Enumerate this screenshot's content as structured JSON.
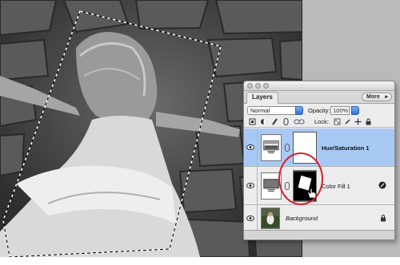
{
  "panel": {
    "tab_label": "Layers",
    "more_label": "More",
    "blend_mode": "Normal",
    "opacity_label": "Opacity:",
    "opacity_value": "100%",
    "lock_label": "Lock:"
  },
  "layers": [
    {
      "name": "Hue/Saturation 1",
      "selected": true
    },
    {
      "name": "Color Fill 1",
      "selected": false
    },
    {
      "name": "Background",
      "selected": false
    }
  ],
  "colors": {
    "selection_highlight": "#a9c9f5",
    "red_ring": "#d8202a",
    "panel_bg": "#ececec"
  },
  "icons": [
    "eye-icon",
    "chain-link-icon",
    "lock-icon",
    "adjustment-layer-icon",
    "hand-cursor-icon",
    "more-arrow-icon"
  ]
}
